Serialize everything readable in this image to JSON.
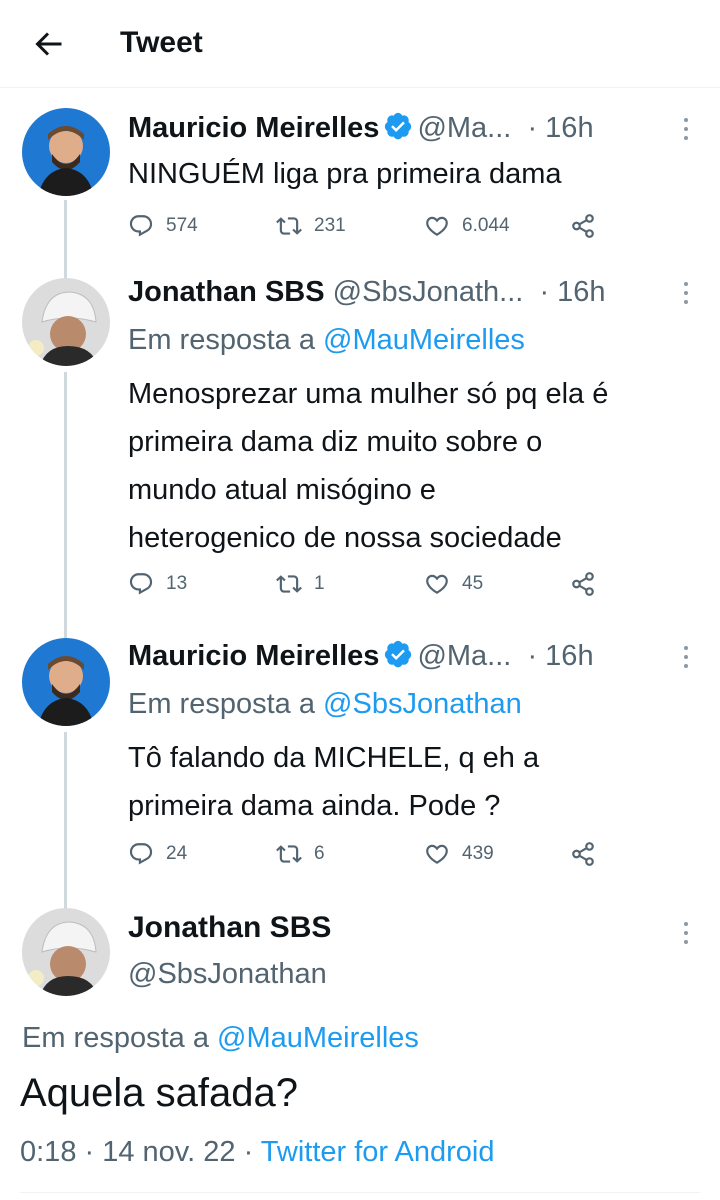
{
  "header": {
    "title": "Tweet"
  },
  "tweets": [
    {
      "name": "Mauricio Meirelles",
      "verified": true,
      "handle": "@Ma...",
      "time": "· 16h",
      "reply_prefix": "",
      "reply_handle": "",
      "text": "NINGUÉM liga pra primeira dama",
      "replies": "574",
      "retweets": "231",
      "likes": "6.044"
    },
    {
      "name": "Jonathan SBS",
      "verified": false,
      "handle": "@SbsJonath...",
      "time": "· 16h",
      "reply_prefix": "Em resposta a ",
      "reply_handle": "@MauMeirelles",
      "text": "Menosprezar uma mulher só pq ela é\nprimeira dama diz muito sobre o\nmundo atual misógino e\nheterogenico de nossa sociedade",
      "replies": "13",
      "retweets": "1",
      "likes": "45"
    },
    {
      "name": "Mauricio Meirelles",
      "verified": true,
      "handle": "@Ma...",
      "time": "· 16h",
      "reply_prefix": "Em resposta a ",
      "reply_handle": "@SbsJonathan",
      "text": "Tô falando da MICHELE, q eh a\nprimeira dama ainda. Pode ?",
      "replies": "24",
      "retweets": "6",
      "likes": "439"
    }
  ],
  "main": {
    "name": "Jonathan SBS",
    "handle": "@SbsJonathan",
    "reply_prefix": "Em resposta a ",
    "reply_handle": "@MauMeirelles",
    "text": "Aquela safada?",
    "time": "0:18",
    "sep1": " · ",
    "date": "14 nov. 22",
    "sep2": " · ",
    "source": "Twitter for Android"
  },
  "colors": {
    "accent": "#1d9bf0",
    "muted": "#536471",
    "text": "#0f1419",
    "thread": "#cfd9de"
  },
  "icons": [
    "back-arrow-icon",
    "verified-badge-icon",
    "more-icon",
    "reply-icon",
    "retweet-icon",
    "like-icon",
    "share-icon"
  ]
}
